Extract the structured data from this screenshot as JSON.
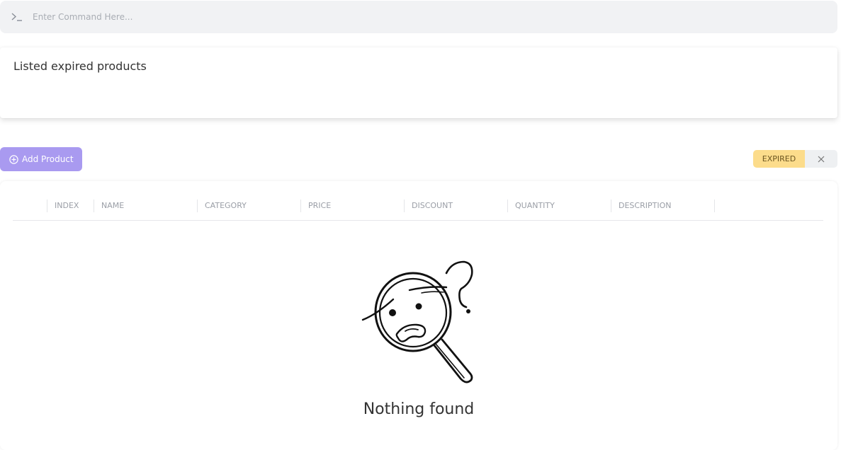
{
  "command": {
    "icon": "terminal-prompt-icon",
    "placeholder": "Enter Command Here..."
  },
  "output": {
    "message": "Listed expired products"
  },
  "toolbar": {
    "add_label": "Add Product",
    "filter_label": "EXPIRED",
    "accent": "#a99af0",
    "filter_color": "#fcdc8b"
  },
  "table": {
    "columns": [
      "INDEX",
      "NAME",
      "CATEGORY",
      "PRICE",
      "DISCOUNT",
      "QUANTITY",
      "DESCRIPTION"
    ],
    "rows": []
  },
  "empty_state": {
    "icon": "magnifier-confused-face-icon",
    "message": "Nothing found"
  }
}
